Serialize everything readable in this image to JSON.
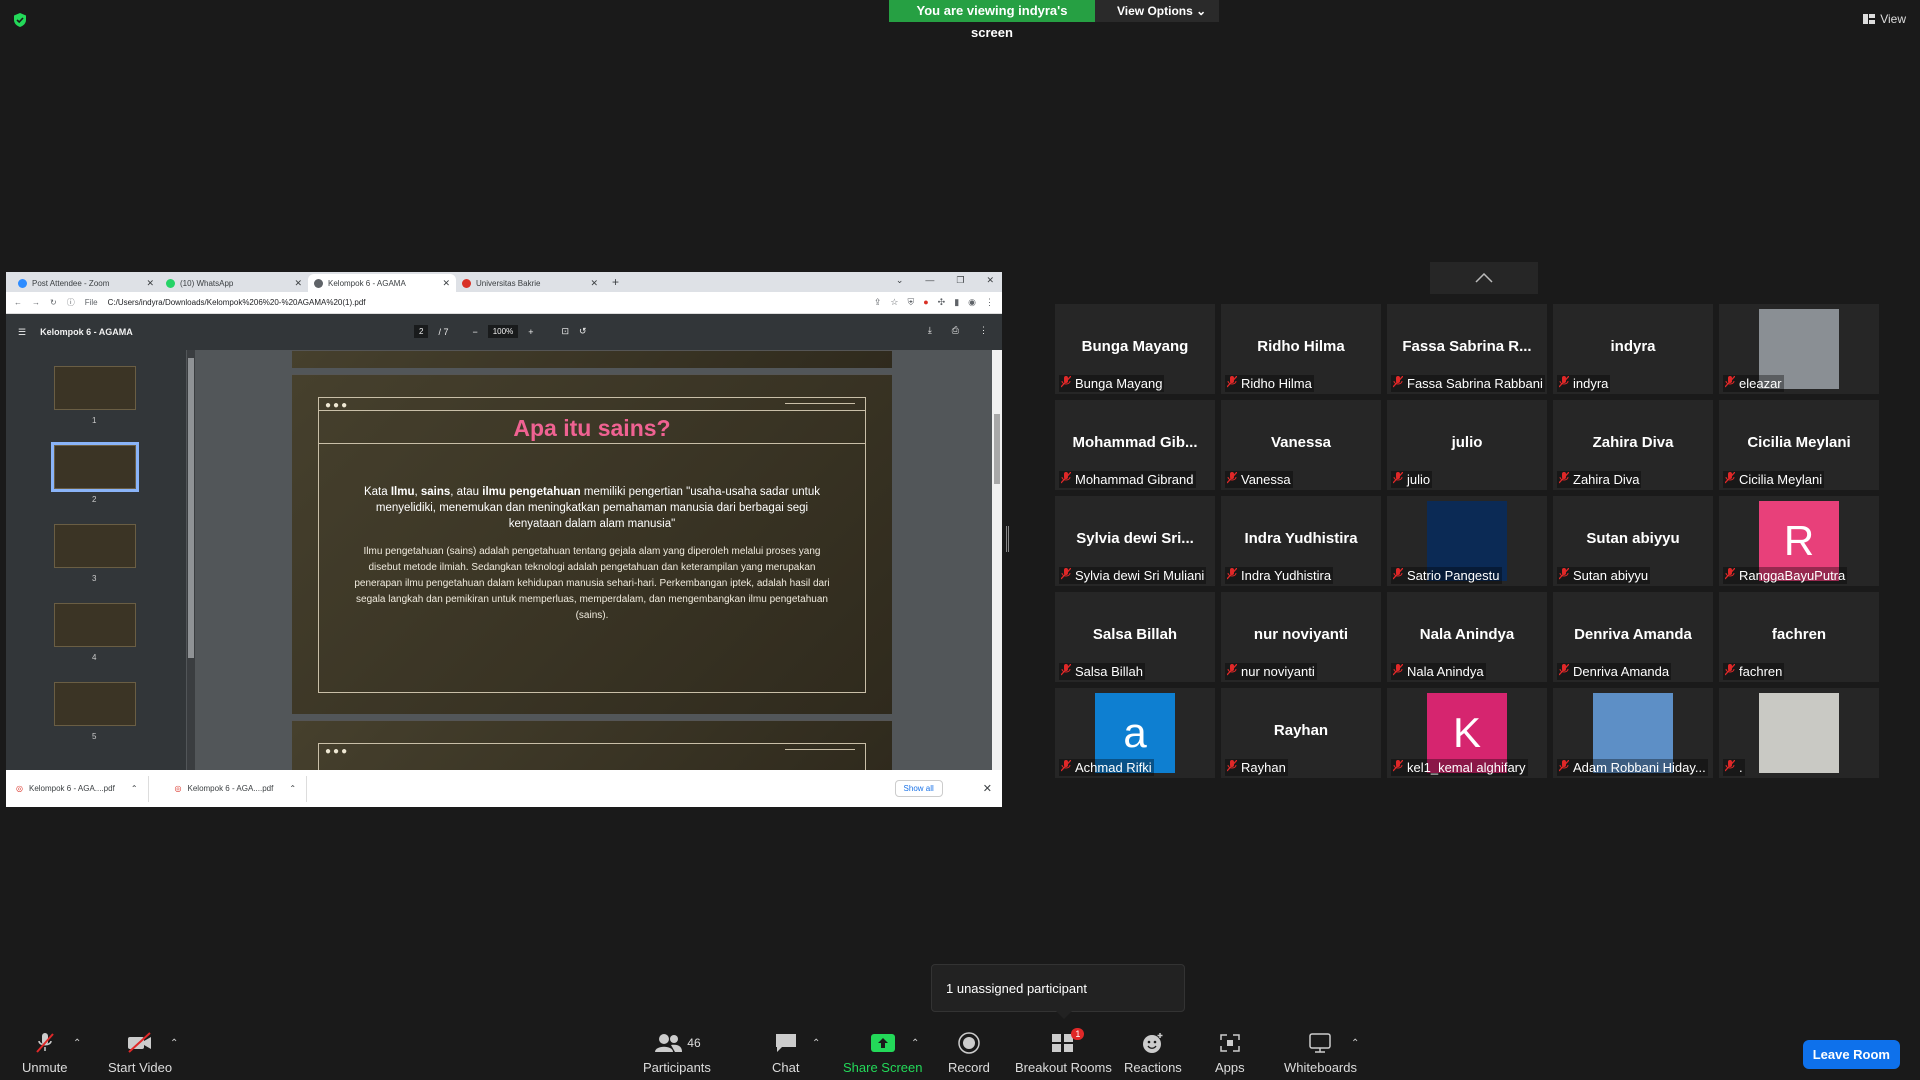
{
  "banner": {
    "viewing_text": "You are viewing indyra's screen",
    "view_options": "View Options"
  },
  "top_right": {
    "view_label": "View"
  },
  "browser": {
    "tabs": [
      {
        "label": "Post Attendee - Zoom"
      },
      {
        "label": "(10) WhatsApp"
      },
      {
        "label": "Kelompok 6 - AGAMA"
      },
      {
        "label": "Universitas Bakrie"
      }
    ],
    "url_prefix": "File",
    "url": "C:/Users/indyra/Downloads/Kelompok%206%20-%20AGAMA%20(1).pdf"
  },
  "pdf": {
    "doc_title": "Kelompok 6 - AGAMA",
    "page_current": "2",
    "page_total": "/ 7",
    "zoom": "100%",
    "thumbs": [
      "1",
      "2",
      "3",
      "4",
      "5"
    ],
    "slide": {
      "title": "Apa itu sains?",
      "para1_a": "Kata ",
      "para1_b": "Ilmu",
      "para1_c": ", ",
      "para1_d": "sains",
      "para1_e": ", atau ",
      "para1_f": "ilmu pengetahuan",
      "para1_g": " memiliki pengertian \"usaha-usaha sadar untuk menyelidiki, menemukan dan meningkatkan pemahaman manusia dari berbagai segi kenyataan dalam alam manusia\"",
      "para2": "Ilmu pengetahuan (sains) adalah pengetahuan tentang gejala alam yang diperoleh melalui proses yang disebut metode ilmiah. Sedangkan teknologi adalah pengetahuan dan keterampilan yang merupakan penerapan ilmu pengetahuan dalam kehidupan manusia sehari-hari. Perkembangan iptek, adalah hasil dari segala langkah dan pemikiran untuk memperluas, memperdalam, dan mengembangkan ilmu pengetahuan (sains)."
    }
  },
  "downloads": {
    "items": [
      "Kelompok 6 - AGA....pdf",
      "Kelompok 6 - AGA....pdf"
    ],
    "show_all": "Show all"
  },
  "participants": [
    {
      "big": "Bunga Mayang",
      "name": "Bunga Mayang"
    },
    {
      "big": "Ridho Hilma",
      "name": "Ridho Hilma"
    },
    {
      "big": "Fassa Sabrina R...",
      "name": "Fassa Sabrina Rabbani"
    },
    {
      "big": "indyra",
      "name": "indyra"
    },
    {
      "big": "",
      "name": "eleazar",
      "avatar": "photo",
      "color": "#8a8f94"
    },
    {
      "big": "Mohammad Gib...",
      "name": "Mohammad Gibrand"
    },
    {
      "big": "Vanessa",
      "name": "Vanessa"
    },
    {
      "big": "julio",
      "name": "julio"
    },
    {
      "big": "Zahira Diva",
      "name": "Zahira Diva"
    },
    {
      "big": "Cicilia Meylani",
      "name": "Cicilia Meylani"
    },
    {
      "big": "Sylvia dewi Sri...",
      "name": "Sylvia dewi Sri Muliani"
    },
    {
      "big": "Indra Yudhistira",
      "name": "Indra Yudhistira"
    },
    {
      "big": "",
      "name": "Satrio Pangestu",
      "avatar": "photo",
      "color": "#0b2a55"
    },
    {
      "big": "Sutan abiyyu",
      "name": "Sutan abiyyu"
    },
    {
      "big": "",
      "name": "RanggaBayuPutra",
      "avatar": "letter",
      "letter": "R",
      "color": "#e8407a"
    },
    {
      "big": "Salsa Billah",
      "name": "Salsa Billah"
    },
    {
      "big": "nur noviyanti",
      "name": "nur noviyanti"
    },
    {
      "big": "Nala Anindya",
      "name": "Nala Anindya"
    },
    {
      "big": "Denriva Amanda",
      "name": "Denriva Amanda"
    },
    {
      "big": "fachren",
      "name": "fachren"
    },
    {
      "big": "",
      "name": "Achmad Rifki",
      "avatar": "letter",
      "letter": "a",
      "color": "#0e7fd1"
    },
    {
      "big": "Rayhan",
      "name": "Rayhan"
    },
    {
      "big": "",
      "name": "kel1_kemal alghifary",
      "avatar": "letter",
      "letter": "K",
      "color": "#d6256f"
    },
    {
      "big": "",
      "name": "Adam Robbani Hiday...",
      "avatar": "photo",
      "color": "#5d8fc6"
    },
    {
      "big": "",
      "name": ".",
      "avatar": "photo",
      "color": "#c9c9c4"
    }
  ],
  "toast": {
    "text": "1 unassigned participant"
  },
  "toolbar": {
    "unmute": "Unmute",
    "start_video": "Start Video",
    "participants": "Participants",
    "participants_count": "46",
    "chat": "Chat",
    "share_screen": "Share Screen",
    "record": "Record",
    "breakout_rooms": "Breakout Rooms",
    "breakout_badge": "1",
    "reactions": "Reactions",
    "apps": "Apps",
    "whiteboards": "Whiteboards",
    "leave_room": "Leave Room"
  },
  "colors": {
    "share_green": "#26a043",
    "leave_blue": "#0e71eb",
    "slide_title_pink": "#f06292",
    "muted_red": "#e02828"
  }
}
